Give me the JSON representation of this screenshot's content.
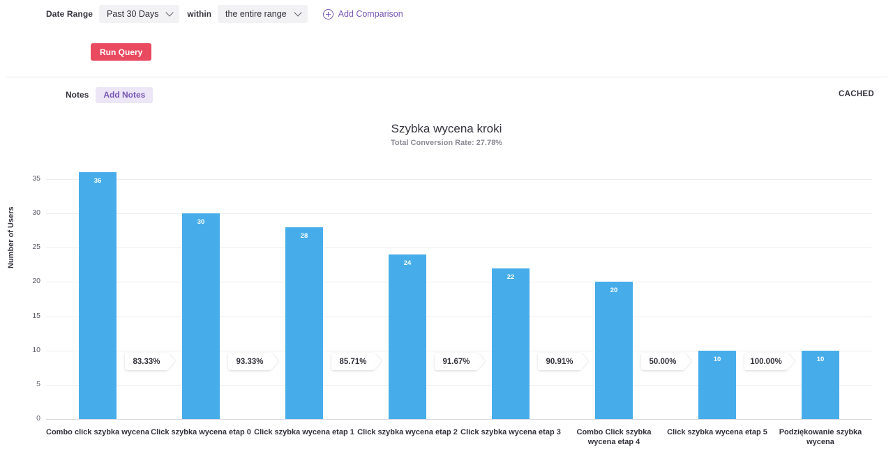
{
  "toolbar": {
    "date_range_label": "Date Range",
    "range_value": "Past 30 Days",
    "within_label": "within",
    "scope_value": "the entire range",
    "add_comparison_label": "Add Comparison"
  },
  "run_query_label": "Run Query",
  "notes": {
    "label": "Notes",
    "add_label": "Add Notes"
  },
  "cached_label": "CACHED",
  "chart_data": {
    "type": "bar",
    "title": "Szybka wycena kroki",
    "subtitle": "Total Conversion Rate: 27.78%",
    "xlabel": "",
    "ylabel": "Number of Users",
    "ylim": [
      0,
      35
    ],
    "yticks": [
      0,
      5,
      10,
      15,
      20,
      25,
      30,
      35
    ],
    "grid": true,
    "legend": "none",
    "bar_color": "#46adea",
    "categories": [
      "Combo click szybka wycena",
      "Click szybka wycena etap 0",
      "Click szybka wycena etap 1",
      "Click szybka wycena etap 2",
      "Click szybka wycena etap 3",
      "Combo Click szybka wycena etap 4",
      "Click szybka wycena etap 5",
      "Podziękowanie szybka wycena"
    ],
    "values": [
      36,
      30,
      28,
      24,
      22,
      20,
      10,
      10
    ],
    "step_conversions": [
      "83.33%",
      "93.33%",
      "85.71%",
      "91.67%",
      "90.91%",
      "50.00%",
      "100.00%"
    ],
    "total_conversion_rate": "27.78%"
  }
}
